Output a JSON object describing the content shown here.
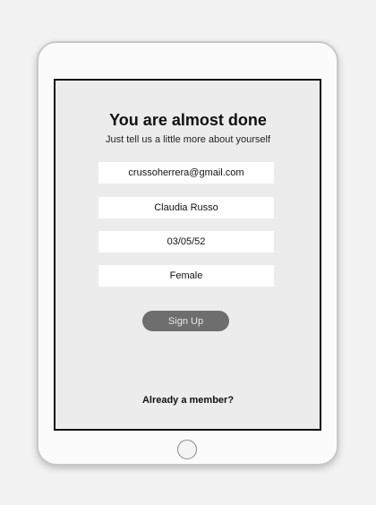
{
  "header": {
    "title": "You are almost done",
    "subtitle": "Just tell us a little more about yourself"
  },
  "form": {
    "email": "crussoherrera@gmail.com",
    "name": "Claudia Russo",
    "birthdate": "03/05/52",
    "gender": "Female",
    "submit_label": "Sign Up"
  },
  "footer": {
    "member_link": "Already a member?"
  }
}
